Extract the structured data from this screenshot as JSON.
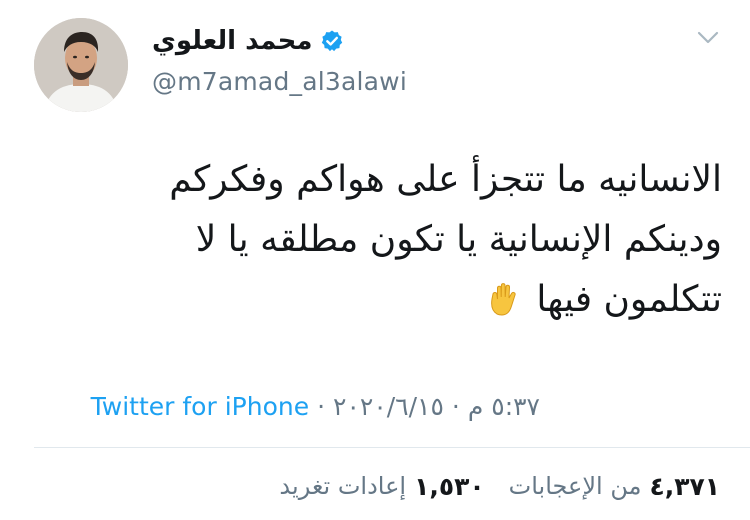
{
  "user": {
    "display_name": "محمد العلوي",
    "handle": "@m7amad_al3alawi",
    "verified": true,
    "avatar_icon": "profile-avatar"
  },
  "tweet": {
    "lines": [
      "الانسانيه ما تتجزأ على هواكم وفكركم",
      "ودينكم الإنسانية يا تكون مطلقه يا لا",
      "تتكلمون فيها"
    ],
    "emoji_icon": "raised-hand-emoji"
  },
  "meta": {
    "time": "٥:٣٧ م",
    "separator": "·",
    "date": "٢٠٢٠/٦/١٥",
    "source": "Twitter for iPhone"
  },
  "stats": {
    "likes_count": "٤,٣٧١",
    "likes_label": "من الإعجابات",
    "retweets_count": "١,٥٣٠",
    "retweets_label": "إعادات تغريد"
  },
  "colors": {
    "text": "#14171a",
    "secondary": "#657786",
    "accent": "#1da1f2",
    "divider": "#e1e8ed",
    "caret": "#aab8c2"
  }
}
